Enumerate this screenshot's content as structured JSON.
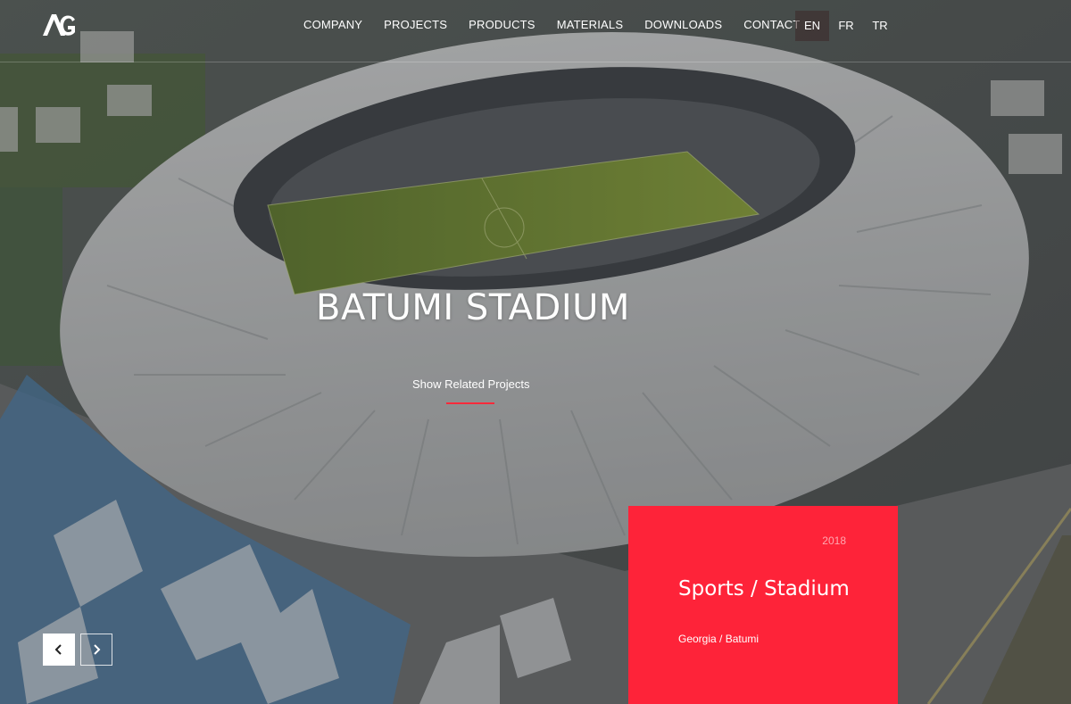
{
  "brand": {
    "logo_text": "AG"
  },
  "nav": {
    "items": [
      {
        "label": "COMPANY"
      },
      {
        "label": "PROJECTS"
      },
      {
        "label": "PRODUCTS"
      },
      {
        "label": "MATERIALS"
      },
      {
        "label": "DOWNLOADS"
      },
      {
        "label": "CONTACT"
      }
    ]
  },
  "languages": [
    {
      "label": "EN",
      "active": true
    },
    {
      "label": "FR",
      "active": false
    },
    {
      "label": "TR",
      "active": false
    }
  ],
  "hero": {
    "title": "BATUMI STADIUM",
    "related_link": "Show Related Projects"
  },
  "card": {
    "year": "2018",
    "category": "Sports / Stadium",
    "location": "Georgia / Batumi"
  },
  "slider": {
    "prev_icon": "chevron-left-icon",
    "next_icon": "chevron-right-icon"
  },
  "colors": {
    "accent": "#fe2339",
    "overlay": "#282828"
  }
}
